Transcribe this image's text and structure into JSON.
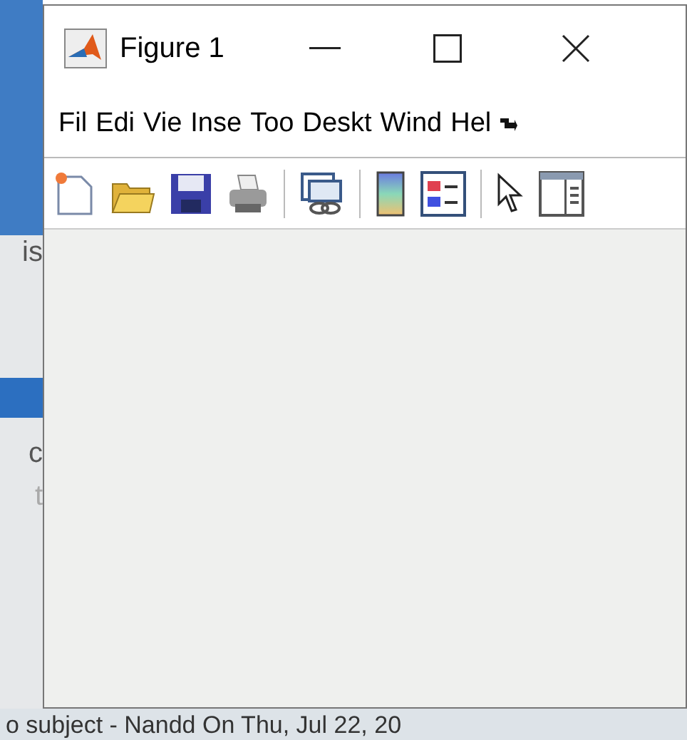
{
  "background": {
    "fragments": [
      "is",
      "c",
      "t"
    ],
    "footer_line": "o subject - Nandd On Thu, Jul 22, 20"
  },
  "window": {
    "title": "Figure 1",
    "menu": [
      "Fil",
      "Edi",
      "Vie",
      "Inse",
      "Too",
      "Deskt",
      "Wind",
      "Hel"
    ]
  }
}
